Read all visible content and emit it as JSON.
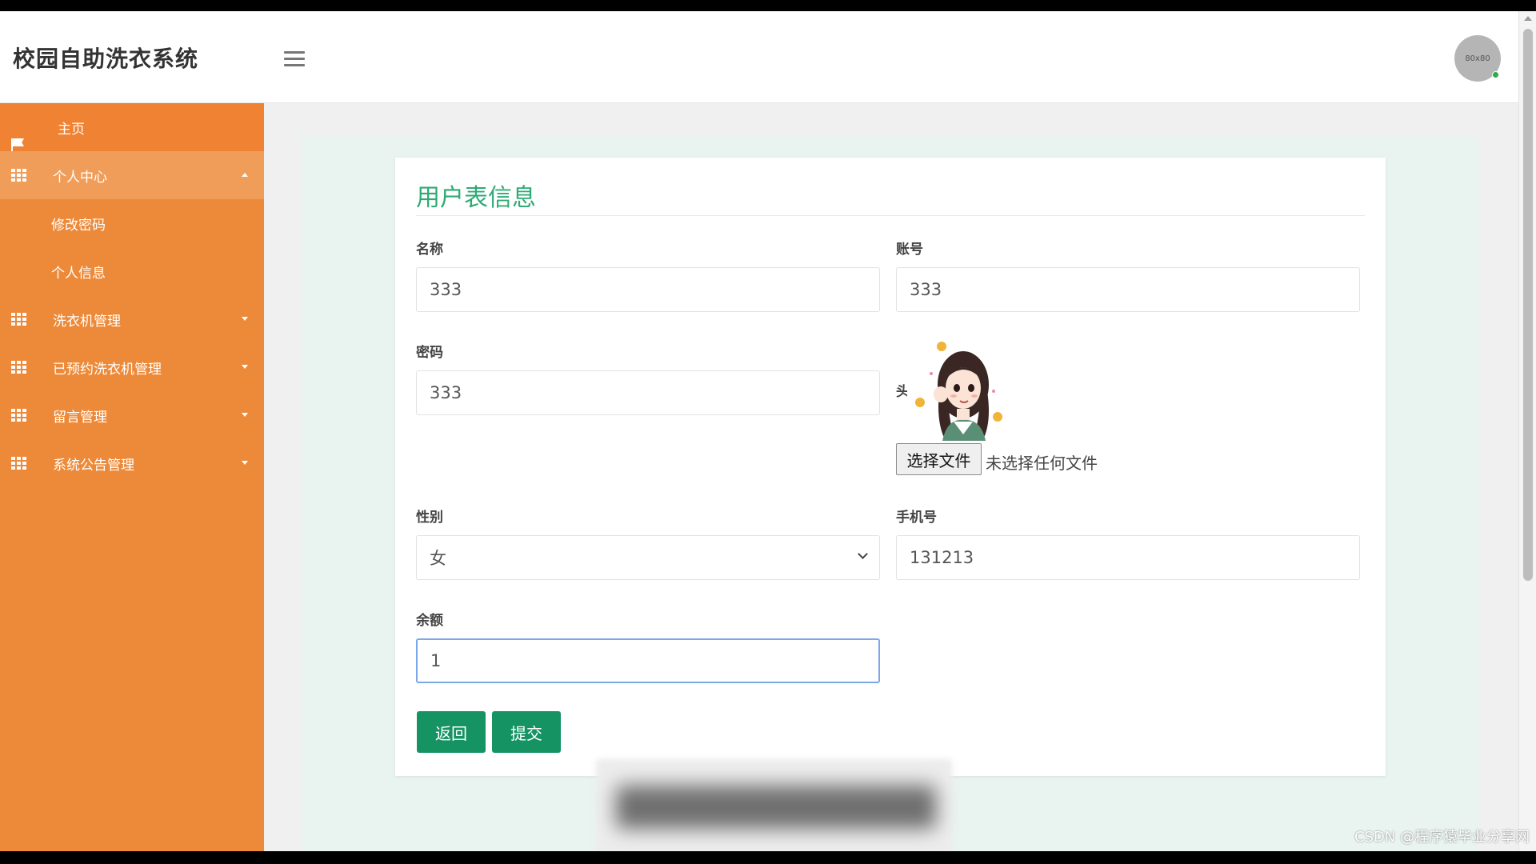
{
  "header": {
    "brand": "校园自助洗衣系统",
    "avatar_text": "80x80"
  },
  "sidebar": {
    "items": [
      {
        "label": "主页",
        "icon": "flag-icon"
      },
      {
        "label": "个人中心",
        "icon": "grid-icon",
        "expanded": true,
        "children": [
          {
            "label": "修改密码"
          },
          {
            "label": "个人信息"
          }
        ]
      },
      {
        "label": "洗衣机管理",
        "icon": "grid-icon"
      },
      {
        "label": "已预约洗衣机管理",
        "icon": "grid-icon"
      },
      {
        "label": "留言管理",
        "icon": "grid-icon"
      },
      {
        "label": "系统公告管理",
        "icon": "grid-icon"
      }
    ]
  },
  "form": {
    "title": "用户表信息",
    "name": {
      "label": "名称",
      "value": "333"
    },
    "account": {
      "label": "账号",
      "value": "333"
    },
    "password": {
      "label": "密码",
      "value": "333"
    },
    "avatar": {
      "label": "头像",
      "choose_button": "选择文件",
      "file_status": "未选择任何文件"
    },
    "gender": {
      "label": "性别",
      "value": "女"
    },
    "phone": {
      "label": "手机号",
      "value": "131213"
    },
    "balance": {
      "label": "余额",
      "value": "1"
    },
    "back_button": "返回",
    "submit_button": "提交"
  },
  "watermark": "CSDN @程序猿毕业分享网",
  "colors": {
    "sidebar": "#ec8a3a",
    "accent_green": "#2eaa74",
    "button_green": "#159363",
    "content_bg": "#e9f3ef"
  }
}
